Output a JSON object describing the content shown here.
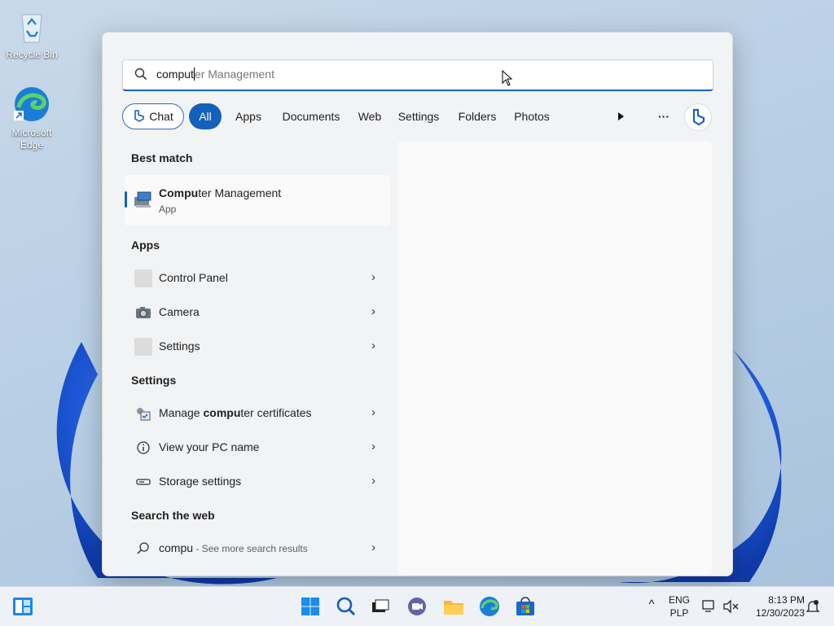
{
  "desktop": {
    "recycle_bin_label": "Recycle Bin",
    "edge_label_line1": "Microsoft",
    "edge_label_line2": "Edge"
  },
  "search": {
    "typed_text": "comput",
    "suggested_rest": "er Management",
    "search_icon": "search-icon"
  },
  "filters": {
    "chat": "Chat",
    "all": "All",
    "apps": "Apps",
    "documents": "Documents",
    "web": "Web",
    "settings": "Settings",
    "folders": "Folders",
    "photos": "Photos",
    "more": "···"
  },
  "best_match": {
    "heading": "Best match",
    "title_bold": "Compu",
    "title_rest": "ter Management",
    "subtitle": "App"
  },
  "apps": {
    "heading": "Apps",
    "items": [
      {
        "label": "Control Panel"
      },
      {
        "label": "Camera"
      },
      {
        "label": "Settings"
      }
    ]
  },
  "settings": {
    "heading": "Settings",
    "items": [
      {
        "pre": "Manage ",
        "bold": "compu",
        "post": "ter certificates"
      },
      {
        "pre": "View your PC name",
        "bold": "",
        "post": ""
      },
      {
        "pre": "Storage settings",
        "bold": "",
        "post": ""
      }
    ]
  },
  "web": {
    "heading": "Search the web",
    "query": "compu",
    "suffix": " - See more search results"
  },
  "taskbar": {
    "lang_line1": "ENG",
    "lang_line2": "PLP",
    "time": "8:13 PM",
    "date": "12/30/2023",
    "chevron": "^"
  },
  "colors": {
    "accent": "#1560bd",
    "flyout_bg": "#f2f3f5"
  }
}
